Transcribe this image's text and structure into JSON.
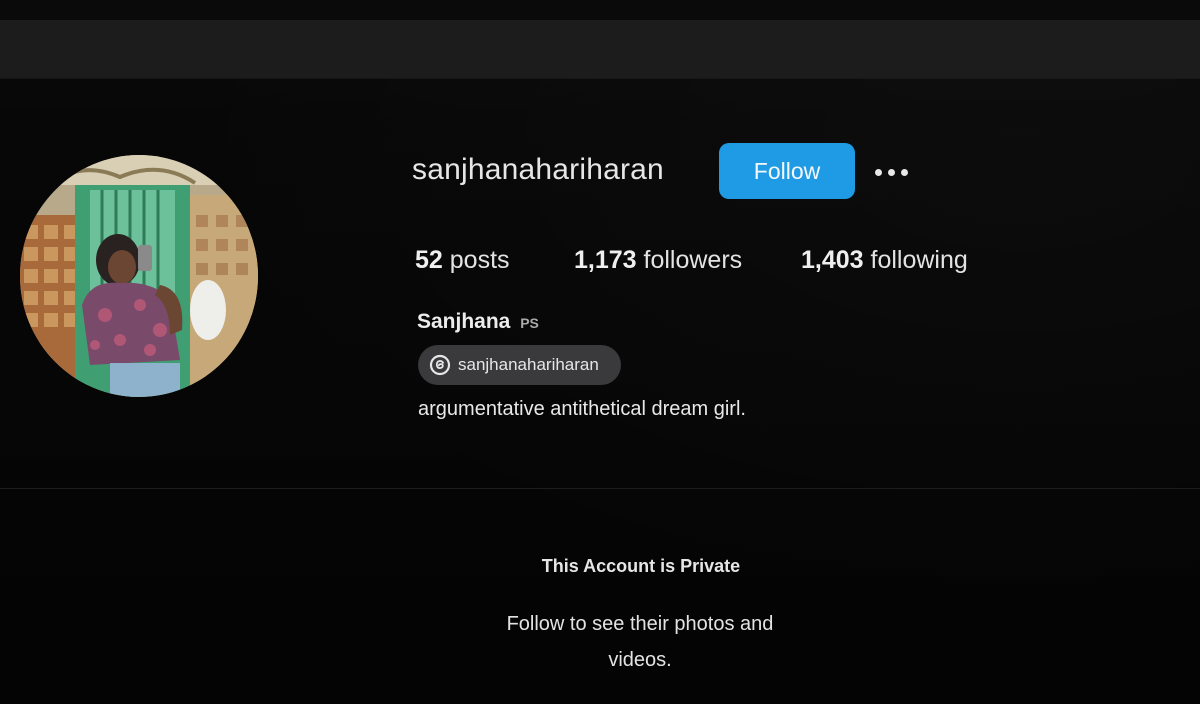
{
  "profile": {
    "username": "sanjhanahariharan",
    "follow_label": "Follow",
    "more_icon": "more-options-icon",
    "stats": {
      "posts_count": "52",
      "posts_label": "posts",
      "followers_count": "1,173",
      "followers_label": "followers",
      "following_count": "1,403",
      "following_label": "following"
    },
    "display_name": "Sanjhana",
    "pronouns": "PS",
    "threads_handle": "sanjhanahariharan",
    "threads_icon": "threads-icon",
    "bio": "argumentative antithetical dream girl."
  },
  "private_notice": {
    "title": "This Account is Private",
    "subtitle": "Follow to see their photos and videos."
  },
  "colors": {
    "accent": "#1f9be6",
    "background": "#050505",
    "chip": "#3a3a3c"
  }
}
